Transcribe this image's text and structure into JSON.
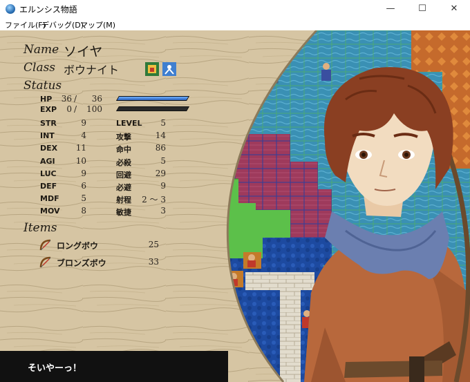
{
  "window": {
    "title": "エルンシス物語",
    "minimize": "—",
    "maximize": "☐",
    "close": "✕"
  },
  "menu": [
    "ファイル(F)",
    "デバッグ(D)",
    "マップ(M)"
  ],
  "unit": {
    "name_label": "Name",
    "name": "ソイヤ",
    "class_label": "Class",
    "class": "ボウナイト",
    "status_label": "Status",
    "hp_label": "HP",
    "hp": "36",
    "hp_max": "36",
    "exp_label": "EXP",
    "exp": "0",
    "exp_max": "100",
    "hp_fraction": 1.0,
    "exp_fraction": 0.0,
    "stats_left": [
      {
        "label": "STR",
        "value": "9"
      },
      {
        "label": "INT",
        "value": "4"
      },
      {
        "label": "DEX",
        "value": "11"
      },
      {
        "label": "AGI",
        "value": "10"
      },
      {
        "label": "LUC",
        "value": "9"
      },
      {
        "label": "DEF",
        "value": "6"
      },
      {
        "label": "MDF",
        "value": "5"
      },
      {
        "label": "MOV",
        "value": "8"
      }
    ],
    "stats_right": [
      {
        "label": "LEVEL",
        "value": "5"
      },
      {
        "label": "攻撃",
        "value": "14"
      },
      {
        "label": "命中",
        "value": "86"
      },
      {
        "label": "必殺",
        "value": "5"
      },
      {
        "label": "回避",
        "value": "29"
      },
      {
        "label": "必避",
        "value": "9"
      },
      {
        "label": "射程",
        "value": "2 〜 3"
      },
      {
        "label": "敏捷",
        "value": "3"
      }
    ],
    "items_label": "Items",
    "items": [
      {
        "name": "ロングボウ",
        "uses": "25",
        "icon": "bow-icon"
      },
      {
        "name": "ブロンズボウ",
        "uses": "33",
        "icon": "bow-icon"
      }
    ]
  },
  "message": "そいやーっ！",
  "colors": {
    "parchment": "#d9c9a8",
    "water": "#3a8fb0",
    "deep_water": "#1d4aa0",
    "grass": "#5cc04a",
    "danger_tile": "#9e3a5c",
    "stone": "#e2dccd"
  }
}
